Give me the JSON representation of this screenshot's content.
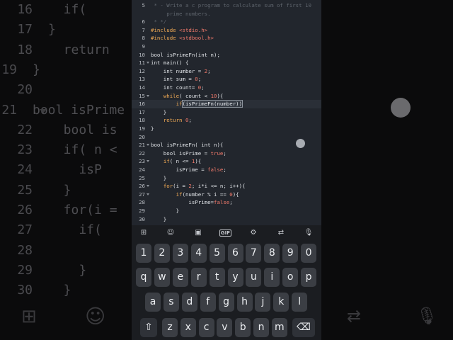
{
  "background": {
    "lines": [
      {
        "n": "16",
        "text": "if(",
        "indent": 1
      },
      {
        "n": "17",
        "text": "}",
        "indent": 0
      },
      {
        "n": "18",
        "text": "return",
        "indent": 1
      },
      {
        "n": "19",
        "text": "}",
        "indent": -1
      },
      {
        "n": "20",
        "text": "",
        "indent": 0
      },
      {
        "n": "21",
        "text": "bool isPrime",
        "indent": -1
      },
      {
        "n": "22",
        "text": "bool is",
        "indent": 1
      },
      {
        "n": "23",
        "text": "if( n <",
        "indent": 1
      },
      {
        "n": "24",
        "text": "isP",
        "indent": 2
      },
      {
        "n": "25",
        "text": "}",
        "indent": 1
      },
      {
        "n": "26",
        "text": "for(i =",
        "indent": 1
      },
      {
        "n": "27",
        "text": "if(",
        "indent": 2
      },
      {
        "n": "28",
        "text": "",
        "indent": 0
      },
      {
        "n": "29",
        "text": "}",
        "indent": 2
      },
      {
        "n": "30",
        "text": "}",
        "indent": 1
      }
    ]
  },
  "editor": {
    "lines": [
      {
        "n": "5",
        "segments": [
          {
            "t": " * - Write a c program to calculate sum of first 10",
            "c": "cmt"
          }
        ]
      },
      {
        "n": "",
        "segments": [
          {
            "t": "     prime numbers.",
            "c": "cmt"
          }
        ]
      },
      {
        "n": "6",
        "segments": [
          {
            "t": " * */",
            "c": "cmt"
          }
        ]
      },
      {
        "n": "7",
        "segments": [
          {
            "t": "#include ",
            "c": "kw"
          },
          {
            "t": "<stdio.h>",
            "c": "str"
          }
        ]
      },
      {
        "n": "8",
        "segments": [
          {
            "t": "#include ",
            "c": "kw"
          },
          {
            "t": "<stdbool.h>",
            "c": "str"
          }
        ]
      },
      {
        "n": "9",
        "segments": []
      },
      {
        "n": "10",
        "segments": [
          {
            "t": "bool isPrimeFn(int n);",
            "c": ""
          }
        ]
      },
      {
        "n": "11",
        "segments": [
          {
            "t": "int main() {",
            "c": ""
          }
        ],
        "fold": true
      },
      {
        "n": "12",
        "segments": [
          {
            "t": "    int number = ",
            "c": ""
          },
          {
            "t": "2",
            "c": "num"
          },
          {
            "t": ";",
            "c": ""
          }
        ]
      },
      {
        "n": "13",
        "segments": [
          {
            "t": "    int sum = ",
            "c": ""
          },
          {
            "t": "0",
            "c": "num"
          },
          {
            "t": ";",
            "c": ""
          }
        ]
      },
      {
        "n": "14",
        "segments": [
          {
            "t": "    int count= ",
            "c": ""
          },
          {
            "t": "0",
            "c": "num"
          },
          {
            "t": ";",
            "c": ""
          }
        ]
      },
      {
        "n": "15",
        "segments": [
          {
            "t": "    ",
            "c": ""
          },
          {
            "t": "while",
            "c": "kw"
          },
          {
            "t": "( count < ",
            "c": ""
          },
          {
            "t": "10",
            "c": "num"
          },
          {
            "t": "){",
            "c": ""
          }
        ],
        "fold": true
      },
      {
        "n": "16",
        "segments": [
          {
            "t": "        ",
            "c": ""
          },
          {
            "t": "if",
            "c": "kw"
          },
          {
            "t": "(isPrimeFn(number))",
            "c": "hl"
          }
        ],
        "active": true
      },
      {
        "n": "17",
        "segments": [
          {
            "t": "    }",
            "c": ""
          }
        ]
      },
      {
        "n": "18",
        "segments": [
          {
            "t": "    ",
            "c": ""
          },
          {
            "t": "return",
            "c": "kw"
          },
          {
            "t": " ",
            "c": ""
          },
          {
            "t": "0",
            "c": "num"
          },
          {
            "t": ";",
            "c": ""
          }
        ]
      },
      {
        "n": "19",
        "segments": [
          {
            "t": "}",
            "c": ""
          }
        ]
      },
      {
        "n": "20",
        "segments": []
      },
      {
        "n": "21",
        "segments": [
          {
            "t": "bool isPrimeFn( int n){",
            "c": ""
          }
        ],
        "fold": true
      },
      {
        "n": "22",
        "segments": [
          {
            "t": "    bool isPrime = ",
            "c": ""
          },
          {
            "t": "true",
            "c": "num"
          },
          {
            "t": ";",
            "c": ""
          }
        ]
      },
      {
        "n": "23",
        "segments": [
          {
            "t": "    ",
            "c": ""
          },
          {
            "t": "if",
            "c": "kw"
          },
          {
            "t": "( n <= ",
            "c": ""
          },
          {
            "t": "1",
            "c": "num"
          },
          {
            "t": "){",
            "c": ""
          }
        ],
        "fold": true
      },
      {
        "n": "24",
        "segments": [
          {
            "t": "        isPrime = ",
            "c": ""
          },
          {
            "t": "false",
            "c": "num"
          },
          {
            "t": ";",
            "c": ""
          }
        ]
      },
      {
        "n": "25",
        "segments": [
          {
            "t": "    }",
            "c": ""
          }
        ]
      },
      {
        "n": "26",
        "segments": [
          {
            "t": "    ",
            "c": ""
          },
          {
            "t": "for",
            "c": "kw"
          },
          {
            "t": "(i = ",
            "c": ""
          },
          {
            "t": "2",
            "c": "num"
          },
          {
            "t": "; i*i <= n; i++){",
            "c": ""
          }
        ],
        "fold": true
      },
      {
        "n": "27",
        "segments": [
          {
            "t": "        ",
            "c": ""
          },
          {
            "t": "if",
            "c": "kw"
          },
          {
            "t": "(number % i == ",
            "c": ""
          },
          {
            "t": "0",
            "c": "num"
          },
          {
            "t": "){",
            "c": ""
          }
        ],
        "fold": true
      },
      {
        "n": "28",
        "segments": [
          {
            "t": "            isPrime=",
            "c": ""
          },
          {
            "t": "false",
            "c": "num"
          },
          {
            "t": ";",
            "c": ""
          }
        ]
      },
      {
        "n": "29",
        "segments": [
          {
            "t": "        }",
            "c": ""
          }
        ]
      },
      {
        "n": "30",
        "segments": [
          {
            "t": "    }",
            "c": ""
          }
        ]
      }
    ]
  },
  "keyboard": {
    "toolbar": [
      {
        "icon": "apps-grid-icon",
        "glyph": "⊞"
      },
      {
        "icon": "emoji-icon",
        "glyph": "☺"
      },
      {
        "icon": "sticker-icon",
        "glyph": "▣"
      },
      {
        "icon": "gif-icon",
        "glyph": "GIF"
      },
      {
        "icon": "settings-gear-icon",
        "glyph": "⚙"
      },
      {
        "icon": "translate-icon",
        "glyph": "⇄"
      },
      {
        "icon": "microphone-icon",
        "glyph": "🎙"
      }
    ],
    "rows": [
      [
        "1",
        "2",
        "3",
        "4",
        "5",
        "6",
        "7",
        "8",
        "9",
        "0"
      ],
      [
        "q",
        "w",
        "e",
        "r",
        "t",
        "y",
        "u",
        "i",
        "o",
        "p"
      ],
      [
        "a",
        "s",
        "d",
        "f",
        "g",
        "h",
        "j",
        "k",
        "l"
      ],
      [
        "⇧",
        "z",
        "x",
        "c",
        "v",
        "b",
        "n",
        "m",
        "⌫"
      ]
    ]
  }
}
